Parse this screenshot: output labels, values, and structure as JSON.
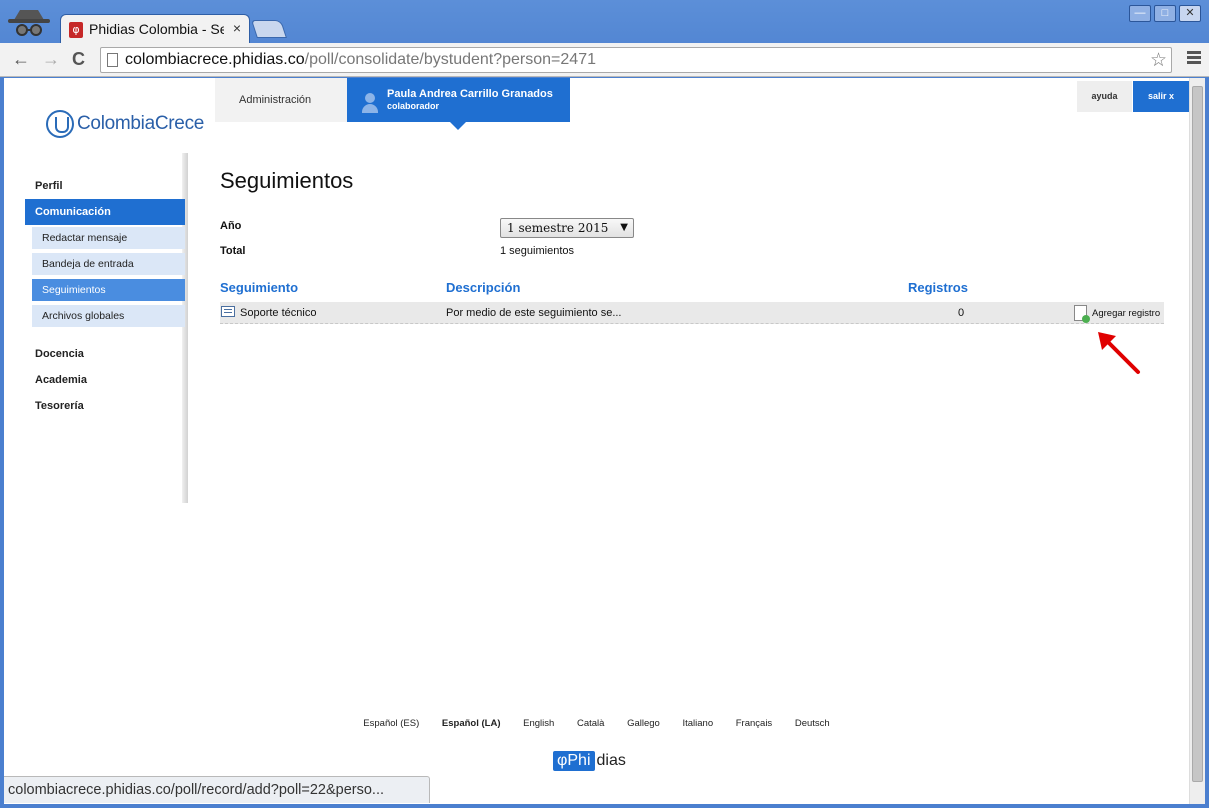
{
  "browser": {
    "tab_title": "Phidias Colombia - Se",
    "tab_favicon": "φ",
    "tab_close": "×",
    "url_host": "colombiacrece.phidias.co",
    "url_path": "/poll/consolidate/bystudent?person=2471",
    "back_icon": "←",
    "forward_icon": "→",
    "reload_icon": "C",
    "star_icon": "☆",
    "window_min": "—",
    "window_max": "□",
    "window_close": "✕"
  },
  "brand": {
    "logo_text": "ColombiaCrece"
  },
  "topnav": {
    "admin_label": "Administración",
    "user_name": "Paula Andrea Carrillo Granados",
    "user_role": "colaborador",
    "help_label": "ayuda",
    "exit_label": "salir x"
  },
  "sidebar": {
    "items": [
      {
        "label": "Perfil"
      },
      {
        "label": "Comunicación"
      },
      {
        "label": "Docencia"
      },
      {
        "label": "Academia"
      },
      {
        "label": "Tesorería"
      }
    ],
    "sub_items": [
      {
        "label": "Redactar mensaje"
      },
      {
        "label": "Bandeja de entrada"
      },
      {
        "label": "Seguimientos"
      },
      {
        "label": "Archivos globales"
      }
    ]
  },
  "main": {
    "title": "Seguimientos",
    "year_label": "Año",
    "year_value": "1 semestre 2015",
    "year_arrow": "▼",
    "total_label": "Total",
    "total_value": "1 seguimientos",
    "table": {
      "headers": [
        "Seguimiento",
        "Descripción",
        "Registros"
      ],
      "rows": [
        {
          "name": "Soporte técnico",
          "description": "Por medio de este seguimiento se...",
          "records": "0",
          "action": "Agregar registro"
        }
      ]
    }
  },
  "footer": {
    "languages": [
      "Español (ES)",
      "Español (LA)",
      "English",
      "Català",
      "Gallego",
      "Italiano",
      "Français",
      "Deutsch"
    ],
    "logo_phi": "Phi",
    "logo_dias": "dias"
  },
  "statusbar": {
    "text": "colombiacrece.phidias.co/poll/record/add?poll=22&perso..."
  },
  "colors": {
    "accent": "#1f6fd1",
    "chrome": "#5a8bd3",
    "annotation": "#e00000"
  }
}
